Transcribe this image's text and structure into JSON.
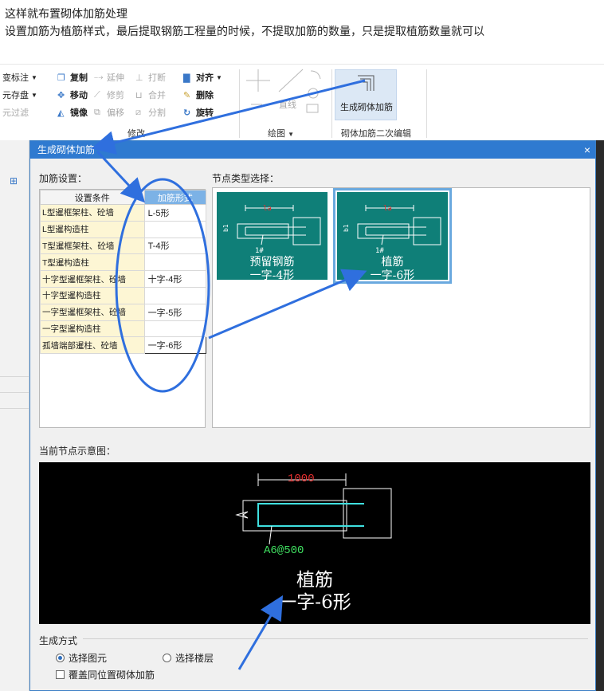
{
  "intro": {
    "line1": "这样就布置砌体加筋处理",
    "line2": "设置加筋为植筋样式，最后提取钢筋工程量的时候，不提取加筋的数量，只是提取植筋数量就可以"
  },
  "ribbon": {
    "left_col": [
      "变标注",
      "元存盘",
      "元过滤"
    ],
    "copy": "复制",
    "extend": "延伸",
    "break": "打断",
    "align": "对齐",
    "move": "移动",
    "trim": "修剪",
    "merge": "合并",
    "delete": "删除",
    "mirror": "镜像",
    "offset": "偏移",
    "split": "分割",
    "rotate": "旋转",
    "modify_group": "修改",
    "line": "直线",
    "draw_group": "绘图",
    "generate_btn": "生成砌体加筋",
    "second_edit_group": "砌体加筋二次编辑"
  },
  "dialog": {
    "title": "生成砌体加筋",
    "close": "×",
    "settings_label": "加筋设置：",
    "node_type_label": "节点类型选择：",
    "table": {
      "headers": [
        "设置条件",
        "加筋形式"
      ],
      "rows": [
        {
          "cond": "L型暹框架柱、砼墙",
          "form": "L-5形"
        },
        {
          "cond": "L型暹构造柱",
          "form": ""
        },
        {
          "cond": "T型暹框架柱、砼墙",
          "form": "T-4形"
        },
        {
          "cond": "T型暹构造柱",
          "form": ""
        },
        {
          "cond": "十字型暹框架柱、砼墙",
          "form": "十字-4形"
        },
        {
          "cond": "十字型暹构造柱",
          "form": ""
        },
        {
          "cond": "一字型暹框架柱、砼墙",
          "form": "一字-5形"
        },
        {
          "cond": "一字型暹构造柱",
          "form": ""
        },
        {
          "cond": "孤墙端部暹柱、砼墙",
          "form": "一字-6形"
        }
      ]
    },
    "nodes": [
      {
        "name1": "预留钢筋",
        "name2": "一字-4形",
        "dim_top": "la",
        "dim_side": "b1",
        "bar": "1#",
        "selected": false
      },
      {
        "name1": "植筋",
        "name2": "一字-6形",
        "dim_top": "la",
        "dim_side": "b1",
        "bar": "1#",
        "selected": true
      }
    ],
    "preview_label": "当前节点示意图：",
    "preview": {
      "dim": "1000",
      "rebar": "A6@500",
      "name1": "植筋",
      "name2": "一字-6形"
    },
    "gen_method_label": "生成方式",
    "radio_element": "选择图元",
    "radio_floor": "选择楼层",
    "radio_selected": "element",
    "overwrite_checkbox": "覆盖同位置砌体加筋"
  },
  "colors": {
    "title_bar": "#2f7ad0",
    "node_bg": "#0f7f78",
    "header_blue": "#7cb2e6",
    "cond_cell": "#fdf6d4",
    "annotation": "#2f6fde"
  }
}
